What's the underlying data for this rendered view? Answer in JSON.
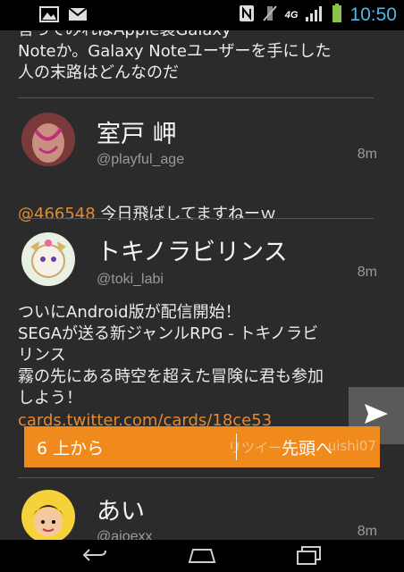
{
  "status_bar": {
    "time": "10:50",
    "network": "4G"
  },
  "tweets": [
    {
      "text_lines": "言ってみればApple製Galaxy\nNoteか。Galaxy Noteユーザーを手にした\n人の末路はどんなのだ"
    },
    {
      "name": "室戸 岬",
      "handle": "@playful_age",
      "time": "8m",
      "mention": "@466548",
      "text": " 今日飛ばしてますねーｗ"
    },
    {
      "name": "トキノラビリンス",
      "handle": "@toki_labi",
      "time": "8m",
      "text": "ついにAndroid版が配信開始！\nSEGAが送る新ジャンルRPG - トキノラビ\nリンス\n霧の先にある時空を超えた冒険に君も参加\nしよう！",
      "link": "cards.twitter.com/cards/18ce53"
    },
    {
      "name": "あい",
      "handle": "@aioexx",
      "time": "8m"
    }
  ],
  "scroll_bar": {
    "count_label": "6 上から",
    "head_label": "先頭へ",
    "ghost_text": "リツイー",
    "ghost_text2": "uishi07"
  },
  "colors": {
    "accent": "#f08a1c",
    "link": "#e68a2e",
    "background": "#2b2b2b",
    "clock": "#4db8e8"
  },
  "icons": [
    "image-icon",
    "mail-icon",
    "nfc-icon",
    "mute-icon",
    "signal-icon",
    "battery-icon",
    "share-arrow-icon",
    "back-icon",
    "home-icon",
    "recents-icon"
  ]
}
